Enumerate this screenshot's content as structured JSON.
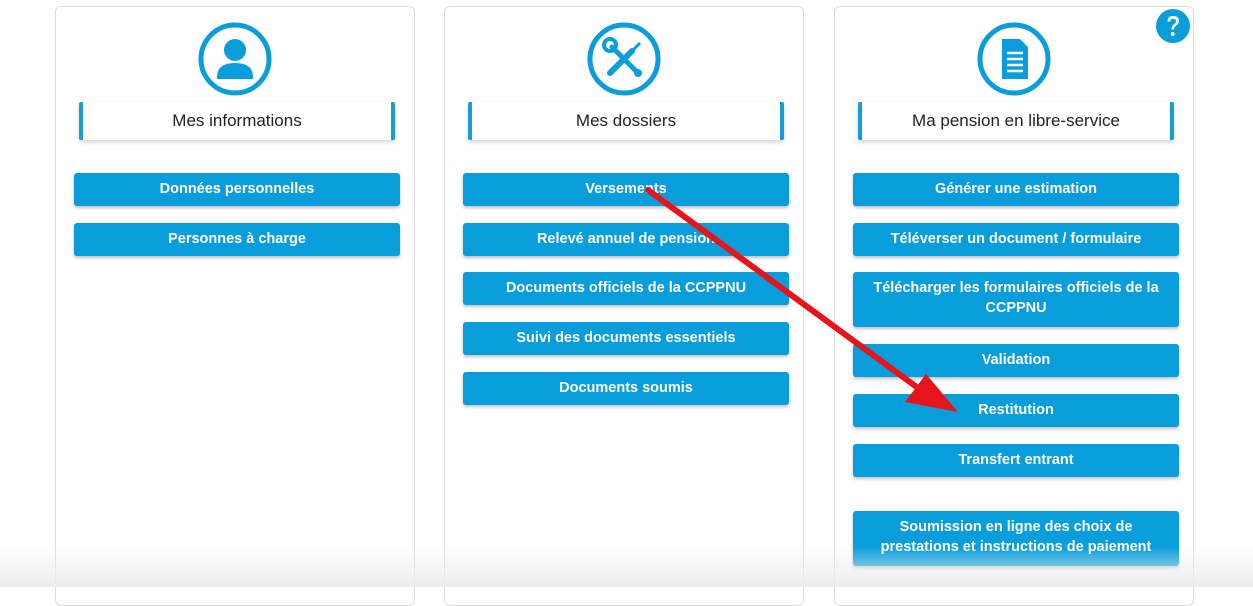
{
  "cards": {
    "info": {
      "title": "Mes informations",
      "icon": "user-icon",
      "buttons": [
        "Données personnelles",
        "Personnes à charge"
      ]
    },
    "dossiers": {
      "title": "Mes dossiers",
      "icon": "tools-icon",
      "buttons": [
        "Versements",
        "Relevé annuel de pension",
        "Documents officiels de la CCPPNU",
        "Suivi des documents essentiels",
        "Documents soumis"
      ]
    },
    "pension": {
      "title": "Ma pension en libre-service",
      "icon": "document-icon",
      "buttons": [
        "Générer une estimation",
        "Téléverser un document / formulaire",
        "Télécharger les formulaires officiels de la CCPPNU",
        "Validation",
        "Restitution",
        "Transfert entrant",
        "Soumission en ligne des choix de prestations et instructions de paiement"
      ]
    }
  },
  "help_icon": "question-circle-icon",
  "colors": {
    "accent": "#0a9ddb",
    "annotation_arrow": "#e8141b"
  }
}
